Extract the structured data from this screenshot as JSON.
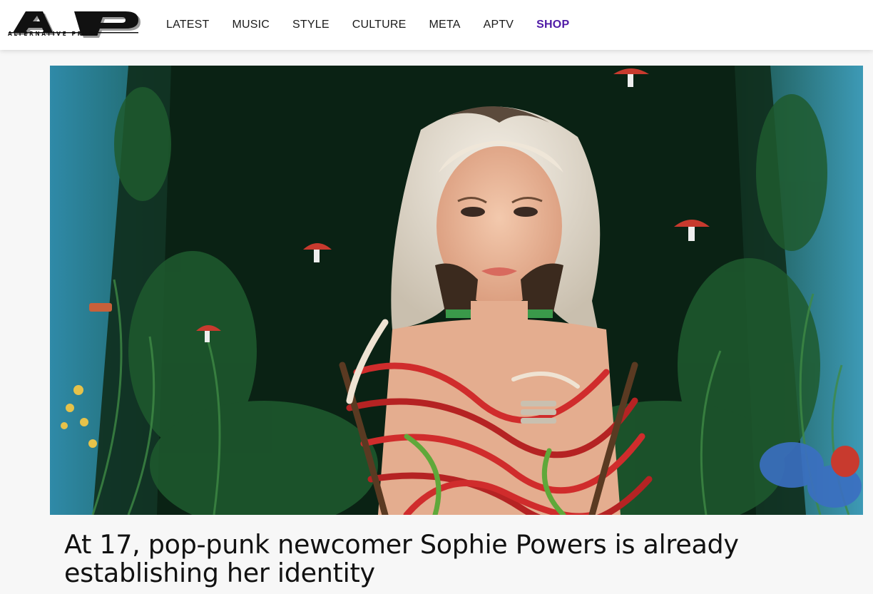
{
  "header": {
    "logo_text": "AP",
    "logo_subtext": "ALTERNATIVE PRESS",
    "nav": [
      {
        "label": "LATEST"
      },
      {
        "label": "MUSIC"
      },
      {
        "label": "STYLE"
      },
      {
        "label": "CULTURE"
      },
      {
        "label": "META"
      },
      {
        "label": "APTV"
      },
      {
        "label": "SHOP"
      }
    ],
    "colors": {
      "shop_accent": "#4f1aa6",
      "background": "#ffffff"
    }
  },
  "article": {
    "hero_image_subject": "portrait of a blonde singer in red yarn among plants and mushrooms",
    "headline": "At 17, pop-punk newcomer Sophie Powers is already establishing her identity"
  }
}
